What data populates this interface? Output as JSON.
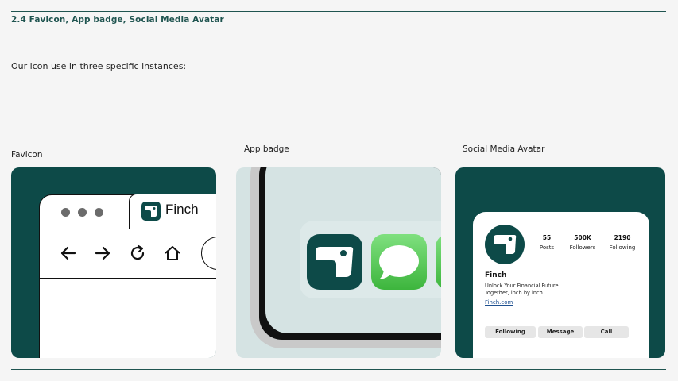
{
  "section": {
    "number_title": "2.4  Favicon, App badge, Social Media Avatar"
  },
  "intro": "Our icon use in three specific instances:",
  "columns": [
    {
      "label": "Favicon"
    },
    {
      "label": "App badge"
    },
    {
      "label": "Social Media Avatar"
    }
  ],
  "favicon": {
    "tab_title": "Finch"
  },
  "social": {
    "stats": [
      {
        "value": "55",
        "label": "Posts"
      },
      {
        "value": "500K",
        "label": "Followers"
      },
      {
        "value": "2190",
        "label": "Following"
      }
    ],
    "name": "Finch",
    "bio_line1": "Unlock Your Financial Future.",
    "bio_line2": "Together, inch by inch.",
    "link": "Finch.com",
    "buttons": [
      "Following",
      "Message",
      "Call"
    ]
  },
  "colors": {
    "brand": "#0d4a48",
    "page": "#f5f5f5",
    "rule": "#1f5450"
  },
  "icons": [
    "finch-logo-icon",
    "back-arrow-icon",
    "forward-arrow-icon",
    "reload-icon",
    "home-icon",
    "messages-app-icon"
  ]
}
